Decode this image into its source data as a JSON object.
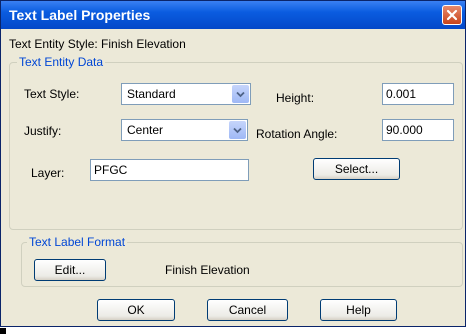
{
  "window": {
    "title": "Text Label Properties"
  },
  "entity_style_text": "Text Entity Style: Finish Elevation",
  "entity_data": {
    "group_title": "Text Entity Data",
    "text_style_label": "Text Style:",
    "text_style_value": "Standard",
    "height_label": "Height:",
    "height_value": "0.001",
    "justify_label": "Justify:",
    "justify_value": "Center",
    "rotation_label": "Rotation Angle:",
    "rotation_value": "90.000",
    "layer_label": "Layer:",
    "layer_value": "PFGC",
    "select_button": "Select..."
  },
  "label_format": {
    "group_title": "Text Label Format",
    "edit_button": "Edit...",
    "format_value": "Finish Elevation"
  },
  "buttons": {
    "ok": "OK",
    "cancel": "Cancel",
    "help": "Help"
  },
  "colors": {
    "titlebar": "#0a5ce0",
    "dialog_bg": "#ece9d8",
    "group_title": "#0046d5",
    "close_button": "#c7431b"
  }
}
